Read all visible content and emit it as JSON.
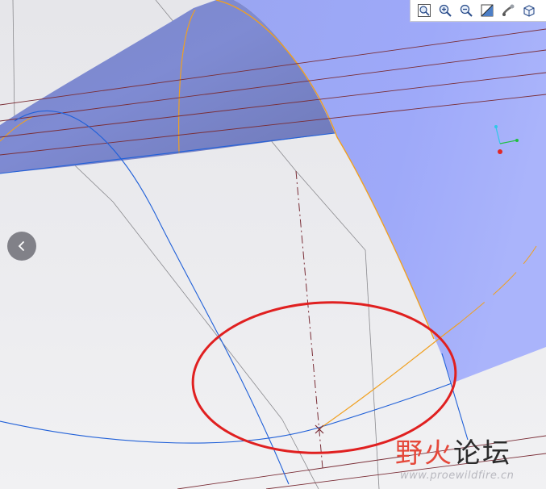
{
  "toolbar": {
    "buttons": [
      {
        "name": "zoom-fit-button",
        "icon": "zoom-fit-icon"
      },
      {
        "name": "zoom-in-button",
        "icon": "zoom-in-icon"
      },
      {
        "name": "zoom-out-button",
        "icon": "zoom-out-icon"
      },
      {
        "name": "repaint-button",
        "icon": "repaint-icon"
      },
      {
        "name": "orient-button",
        "icon": "orient-icon"
      },
      {
        "name": "display-style-button",
        "icon": "cube-icon"
      }
    ]
  },
  "navigation": {
    "back_icon": "chevron-left-icon"
  },
  "watermark": {
    "title_red": "野火",
    "title_dark": "论坛",
    "url": "www.proewildfire.cn"
  },
  "colors": {
    "surface": "#8f9df5",
    "surface_edge": "#f0a020",
    "curve_blue": "#2060d8",
    "datum_red": "#7a2d36",
    "highlight_circle": "#e02020"
  }
}
